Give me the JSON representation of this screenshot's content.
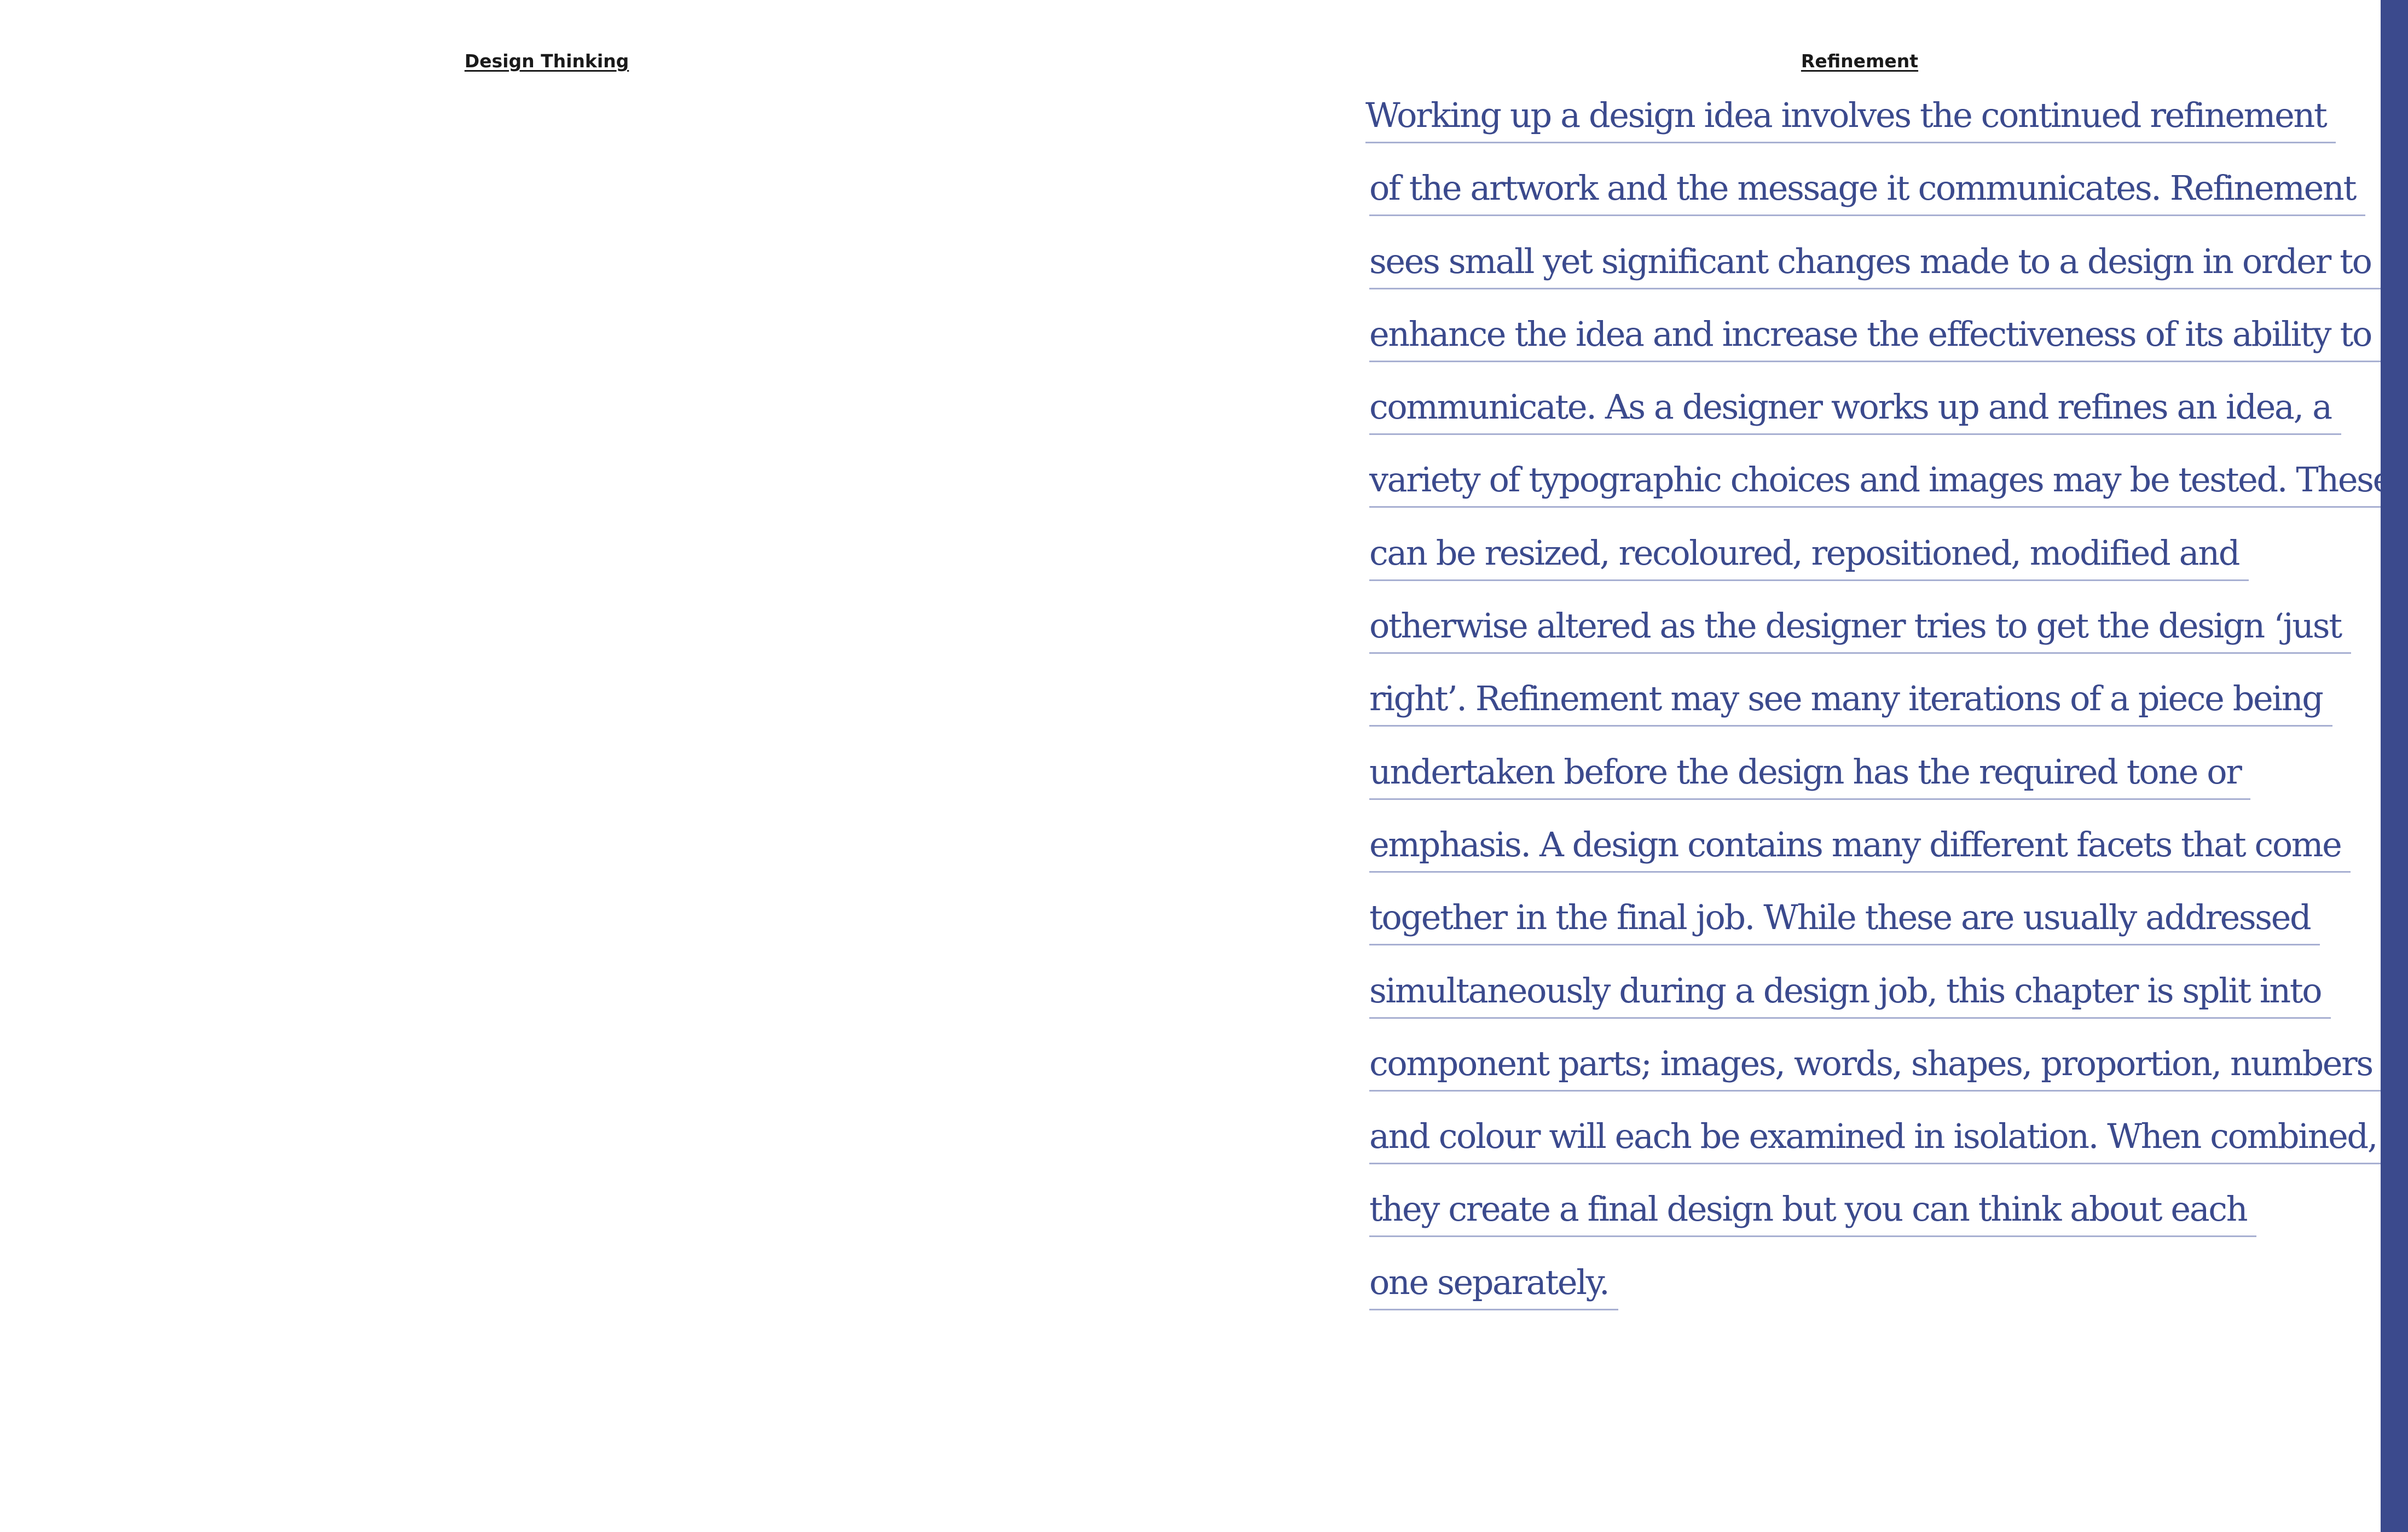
{
  "spread": {
    "left_running_head": "Design Thinking",
    "right_running_head": "Refinement",
    "body_lines": [
      "Working up a design idea involves the continued refinement",
      "of the artwork and the message it communicates. Refinement",
      "sees small yet significant changes made to a design in order to",
      "enhance the idea and increase the effectiveness of its ability to",
      "communicate. As a designer works up and refines an idea, a",
      "variety of typographic choices and images may be tested. These",
      "can be resized, recoloured, repositioned, modified and",
      "otherwise altered as the designer tries to get the design ‘just",
      "right’. Refinement may see many iterations of a piece being",
      "undertaken before the design has the required tone or",
      "emphasis. A design contains many different facets that come",
      "together in the final job. While these are usually addressed",
      "simultaneously during a design job, this chapter is split into",
      "component parts; images, words, shapes, proportion, numbers",
      "and colour will each be examined in isolation. When combined,",
      "they create a final design but you can think about each",
      "one separately."
    ]
  },
  "colors": {
    "text_accent": "#3b4a8d",
    "edge_bar": "#3b4a8d",
    "running_head": "#1a1a1a",
    "background": "#ffffff"
  }
}
